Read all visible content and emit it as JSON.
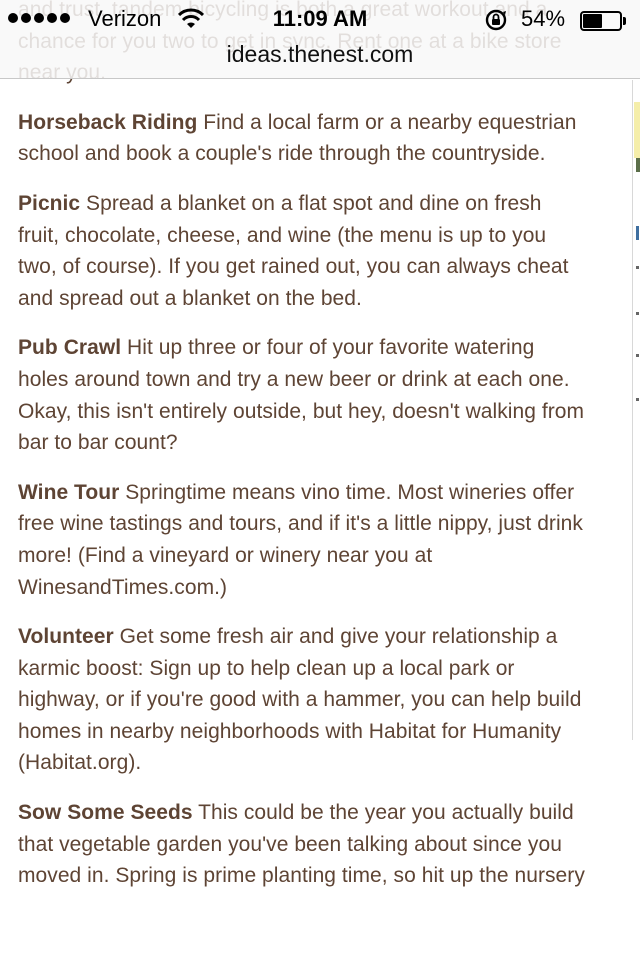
{
  "status_bar": {
    "carrier": "Verizon",
    "time": "11:09 AM",
    "battery_percent": "54%",
    "battery_level": 0.54,
    "icons": [
      "signal-dots-icon",
      "wifi-icon",
      "rotation-lock-icon",
      "battery-icon"
    ]
  },
  "browser": {
    "url": "ideas.thenest.com"
  },
  "article": {
    "items": [
      {
        "term": "",
        "lines": [
          "and trust, tandem bicycling is both a great workout and a",
          "chance for you two to get in sync. Rent one at a bike store",
          "near you."
        ]
      },
      {
        "term": "Horseback Riding",
        "lines": [
          " Find a local farm or a nearby equestrian",
          "school and book a couple's ride through the countryside."
        ]
      },
      {
        "term": "Picnic",
        "lines": [
          " Spread a blanket on a flat spot and dine on fresh",
          "fruit, chocolate, cheese, and wine (the menu is up to you",
          "two, of course). If you get rained out, you can always cheat",
          "and spread out a blanket on the bed."
        ]
      },
      {
        "term": "Pub Crawl",
        "lines": [
          " Hit up three or four of your favorite watering",
          "holes around town and try a new beer or drink at each one.",
          "Okay, this isn't entirely outside, but hey, doesn't walking from",
          "bar to bar count?"
        ]
      },
      {
        "term": "Wine Tour",
        "lines": [
          " Springtime means vino time. Most wineries offer",
          "free wine tastings and tours, and if it's a little nippy, just drink",
          "more! (Find a vineyard or winery near you at",
          "WinesandTimes.com.)"
        ]
      },
      {
        "term": "Volunteer",
        "lines": [
          " Get some fresh air and give your relationship a",
          "karmic boost: Sign up to help clean up a local park or",
          "highway, or if you're good with a hammer, you can help build",
          "homes in nearby neighborhoods with Habitat for Humanity",
          "(Habitat.org)."
        ]
      },
      {
        "term": "Sow Some Seeds",
        "lines": [
          " This could be the year you actually build",
          "that vegetable garden you've been talking about since you",
          "moved in. Spring is prime planting time, so hit up the nursery"
        ]
      }
    ]
  },
  "colors": {
    "body_text": "#5e4434",
    "status_bar_bg": "#f8f8f8",
    "page_bg": "#ffffff"
  }
}
